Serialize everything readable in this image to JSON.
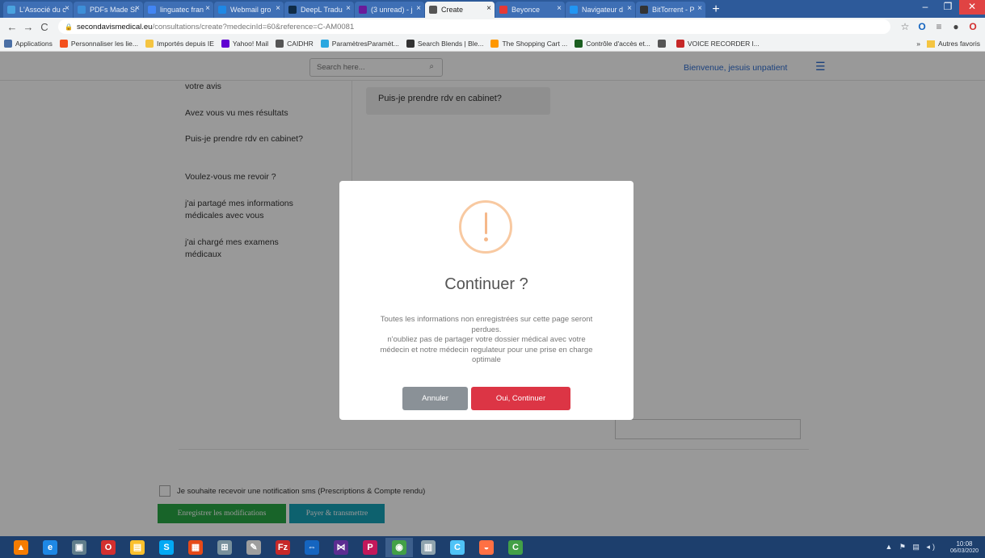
{
  "browser": {
    "tabs": [
      {
        "label": "L'Associé du c",
        "color": "#4aa3df"
      },
      {
        "label": "PDFs Made Si",
        "color": "#3d8fd8"
      },
      {
        "label": "linguatec fran",
        "color": "#4285f4"
      },
      {
        "label": "Webmail gro",
        "color": "#1e88e5"
      },
      {
        "label": "DeepL Tradu",
        "color": "#0f2b46"
      },
      {
        "label": "(3 unread) - j",
        "color": "#6a1b9a"
      },
      {
        "label": "Create",
        "color": "#555555"
      },
      {
        "label": "Beyonce",
        "color": "#e53935"
      },
      {
        "label": "Navigateur d",
        "color": "#2196f3"
      },
      {
        "label": "BitTorrent - P",
        "color": "#333333"
      }
    ],
    "new_tab_label": "+",
    "window_controls": {
      "minimize": "–",
      "maximize": "❐",
      "close": "✕"
    },
    "nav": {
      "back": "←",
      "forward": "→",
      "reload": "C"
    },
    "url": {
      "host": "secondavismedical.eu",
      "path": "/consultations/create?medecinId=60&reference=C-AM0081"
    },
    "bookmarks": [
      {
        "label": "Applications",
        "color": "#4a6fa5"
      },
      {
        "label": "Personnaliser les lie...",
        "color": "#f4511e"
      },
      {
        "label": "Importés depuis IE",
        "color": "#f5c542"
      },
      {
        "label": "Yahoo! Mail",
        "color": "#6001d2"
      },
      {
        "label": "CAIDHR",
        "color": "#555555"
      },
      {
        "label": "ParamètresParamèt...",
        "color": "#2aa7e0"
      },
      {
        "label": "Search Blends | Ble...",
        "color": "#333333"
      },
      {
        "label": "The Shopping Cart ...",
        "color": "#ff9800"
      },
      {
        "label": "Contrôle d'accès et...",
        "color": "#1b5e20"
      },
      {
        "label": "",
        "color": "#555555"
      },
      {
        "label": "VOICE RECORDER l...",
        "color": "#c62828"
      }
    ],
    "bookmarks_more": "»",
    "other_bookmarks": "Autres favoris"
  },
  "header": {
    "search_placeholder": "Search here...",
    "welcome": "Bienvenue, jesuis unpatient"
  },
  "sidebar": {
    "items": [
      "votre avis",
      "Avez vous vu mes résultats",
      "Puis-je prendre rdv en cabinet?",
      "Voulez-vous me revoir ?",
      "j'ai partagé mes informations médicales avec vous",
      "j'ai chargé mes examens médicaux"
    ]
  },
  "chat": {
    "message": "Puis-je prendre rdv en cabinet?"
  },
  "form": {
    "sms_label": "Je souhaite recevoir une notification sms (Prescriptions & Compte rendu)",
    "save_label": "Enregistrer les modifications",
    "pay_label": "Payer & transmettre"
  },
  "modal": {
    "title": "Continuer ?",
    "text_lines": [
      "Toutes les informations non enregistrées sur cette page seront",
      "perdues.",
      "n'oubliez pas de partager votre dossier médical avec votre",
      "médecin et notre médecin regulateur pour une prise en charge",
      "optimale"
    ],
    "cancel_label": "Annuler",
    "confirm_label": "Oui, Continuer",
    "icon_color": "#f8bb86",
    "confirm_color": "#dc3545",
    "cancel_color": "#8a9197"
  },
  "taskbar": {
    "apps": [
      {
        "icon": "vlc-icon",
        "color": "#f57c00",
        "glyph": "▲"
      },
      {
        "icon": "internet-explorer-icon",
        "color": "#1e88e5",
        "glyph": "e"
      },
      {
        "icon": "app-icon",
        "color": "#607d8b",
        "glyph": "▣"
      },
      {
        "icon": "opera-icon",
        "color": "#d32f2f",
        "glyph": "O"
      },
      {
        "icon": "file-explorer-icon",
        "color": "#fbc02d",
        "glyph": "▤"
      },
      {
        "icon": "skype-icon",
        "color": "#03a9f4",
        "glyph": "S"
      },
      {
        "icon": "media-icon",
        "color": "#e64a19",
        "glyph": "▦"
      },
      {
        "icon": "network-icon",
        "color": "#78909c",
        "glyph": "⊞"
      },
      {
        "icon": "pen-icon",
        "color": "#9e9e9e",
        "glyph": "✎"
      },
      {
        "icon": "filezilla-icon",
        "color": "#c62828",
        "glyph": "Fz"
      },
      {
        "icon": "teamviewer-icon",
        "color": "#1565c0",
        "glyph": "⇔"
      },
      {
        "icon": "visual-studio-icon",
        "color": "#5c2d91",
        "glyph": "⋈"
      },
      {
        "icon": "p-app-icon",
        "color": "#c2185b",
        "glyph": "P"
      },
      {
        "icon": "chrome-icon",
        "color": "#43a047",
        "glyph": "◉",
        "active": true
      },
      {
        "icon": "word-icon",
        "color": "#90a4ae",
        "glyph": "▥"
      },
      {
        "icon": "c-app-icon",
        "color": "#4fc3f7",
        "glyph": "C"
      },
      {
        "icon": "remote-icon",
        "color": "#ff7043",
        "glyph": "◒"
      },
      {
        "icon": "camtasia-icon",
        "color": "#43a047",
        "glyph": "C"
      }
    ],
    "time": "10:08",
    "date": "06/03/2020"
  }
}
